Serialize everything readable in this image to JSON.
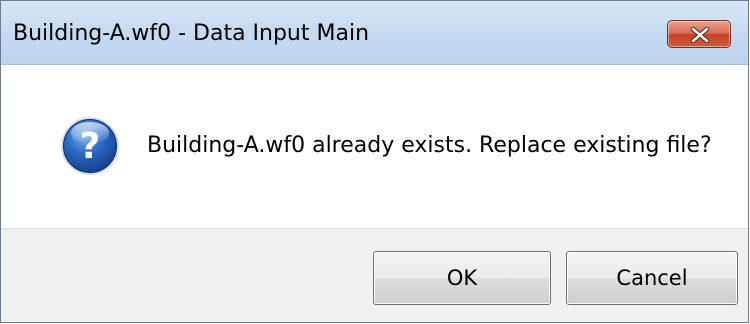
{
  "window": {
    "title": "Building-A.wf0 - Data Input Main",
    "close_icon": "close-x-icon",
    "accent_colors": {
      "titlebar": "#c7dbf1",
      "close_button": "#c7432b",
      "footer": "#f0f0f0"
    }
  },
  "dialog": {
    "icon": "question-icon",
    "message": "Building-A.wf0 already exists.  Replace existing file?"
  },
  "buttons": {
    "ok_label": "OK",
    "cancel_label": "Cancel"
  }
}
